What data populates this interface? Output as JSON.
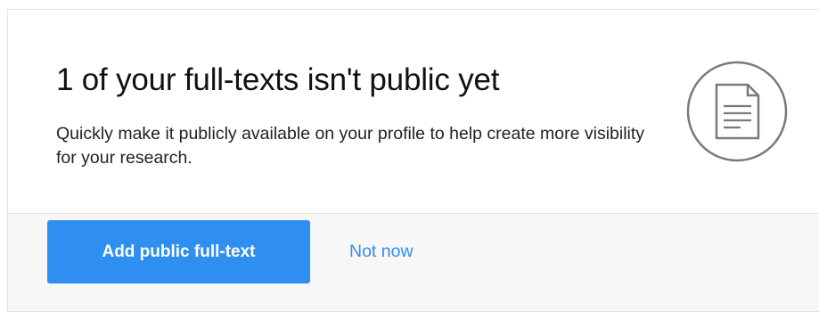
{
  "prompt": {
    "title": "1 of your full-texts isn't public yet",
    "description": "Quickly make it publicly available on your profile to help create more visibility for your research.",
    "icon": "document-icon"
  },
  "actions": {
    "primary_label": "Add public full-text",
    "secondary_label": "Not now"
  },
  "colors": {
    "accent": "#2f8ff0",
    "footer_background": "#f7f7f7",
    "border": "#e3e3e3"
  }
}
